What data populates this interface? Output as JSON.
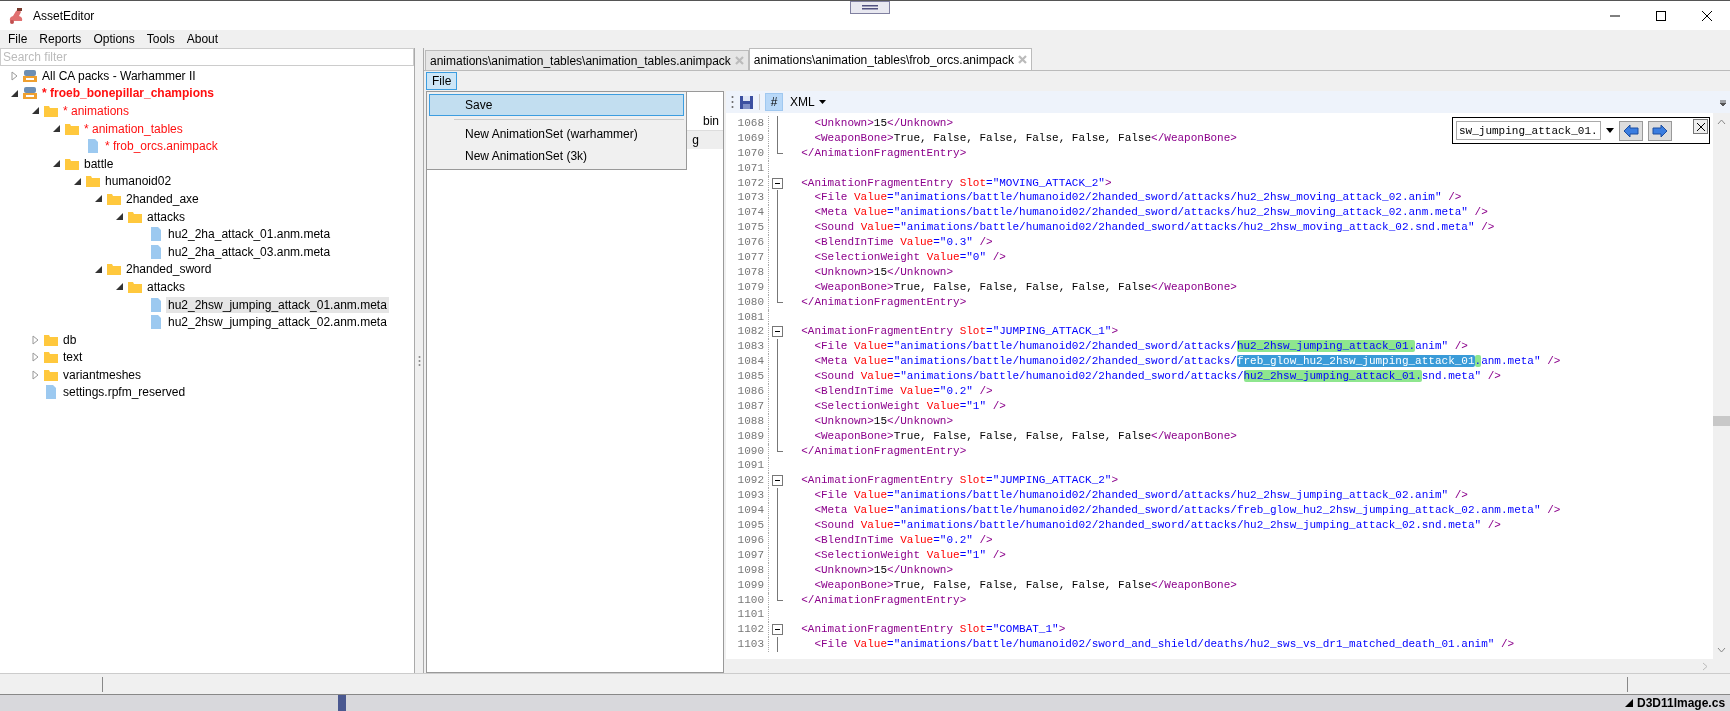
{
  "window": {
    "title": "AssetEditor"
  },
  "menu": [
    "File",
    "Reports",
    "Options",
    "Tools",
    "About"
  ],
  "sidebar": {
    "search": {
      "placeholder": "Search filter"
    },
    "tree": [
      {
        "kind": "pack",
        "label": "All CA packs - Warhammer II",
        "modified": false,
        "expanded": false,
        "selected": false
      },
      {
        "kind": "pack",
        "label": "* froeb_bonepillar_champions",
        "modified": true,
        "expanded": true,
        "selected": false,
        "children": [
          {
            "kind": "folder",
            "label": "* animations",
            "modified": true,
            "expanded": true,
            "selected": false,
            "children": [
              {
                "kind": "folder",
                "label": "* animation_tables",
                "modified": true,
                "expanded": true,
                "selected": false,
                "children": [
                  {
                    "kind": "file",
                    "label": "* frob_orcs.animpack",
                    "modified": true,
                    "selected": false
                  }
                ]
              },
              {
                "kind": "folder",
                "label": "battle",
                "modified": false,
                "expanded": true,
                "selected": false,
                "children": [
                  {
                    "kind": "folder",
                    "label": "humanoid02",
                    "modified": false,
                    "expanded": true,
                    "selected": false,
                    "children": [
                      {
                        "kind": "folder",
                        "label": "2handed_axe",
                        "modified": false,
                        "expanded": true,
                        "selected": false,
                        "children": [
                          {
                            "kind": "folder",
                            "label": "attacks",
                            "modified": false,
                            "expanded": true,
                            "selected": false,
                            "children": [
                              {
                                "kind": "file",
                                "label": "hu2_2ha_attack_01.anm.meta",
                                "modified": false,
                                "selected": false
                              },
                              {
                                "kind": "file",
                                "label": "hu2_2ha_attack_03.anm.meta",
                                "modified": false,
                                "selected": false
                              }
                            ]
                          }
                        ]
                      },
                      {
                        "kind": "folder",
                        "label": "2handed_sword",
                        "modified": false,
                        "expanded": true,
                        "selected": false,
                        "children": [
                          {
                            "kind": "folder",
                            "label": "attacks",
                            "modified": false,
                            "expanded": true,
                            "selected": false,
                            "children": [
                              {
                                "kind": "file",
                                "label": "hu2_2hsw_jumping_attack_01.anm.meta",
                                "modified": false,
                                "selected": true
                              },
                              {
                                "kind": "file",
                                "label": "hu2_2hsw_jumping_attack_02.anm.meta",
                                "modified": false,
                                "selected": false
                              }
                            ]
                          }
                        ]
                      }
                    ]
                  }
                ]
              }
            ]
          },
          {
            "kind": "folder",
            "label": "db",
            "modified": false,
            "expanded": false,
            "selected": false
          },
          {
            "kind": "folder",
            "label": "text",
            "modified": false,
            "expanded": false,
            "selected": false
          },
          {
            "kind": "folder",
            "label": "variantmeshes",
            "modified": false,
            "expanded": false,
            "selected": false
          },
          {
            "kind": "file",
            "label": "settings.rpfm_reserved",
            "modified": false,
            "selected": false
          }
        ]
      }
    ]
  },
  "tabs": [
    {
      "label": "animations\\animation_tables\\animation_tables.animpack",
      "selected": false
    },
    {
      "label": "animations\\animation_tables\\frob_orcs.animpack",
      "selected": true
    }
  ],
  "document": {
    "menu": [
      {
        "label": "File",
        "open": true
      }
    ],
    "file_menu": [
      {
        "kind": "item",
        "label": "Save",
        "selected": true
      },
      {
        "kind": "separator"
      },
      {
        "kind": "item",
        "label": "New AnimationSet (warhammer)",
        "selected": false
      },
      {
        "kind": "item",
        "label": "New AnimationSet (3k)",
        "selected": false
      }
    ],
    "table": {
      "columns": [
        "bin"
      ],
      "rows": [
        [
          "g"
        ]
      ]
    },
    "editor": {
      "toolbar": {
        "hash_toggle": {
          "label": "#",
          "on": true
        },
        "language": "XML"
      },
      "find": {
        "value": "sw_jumping_attack_01."
      },
      "lines": [
        {
          "number": "1068",
          "kind": "body",
          "tokens": [
            {
              "kind": "tag",
              "text": "    <Unknown>"
            },
            {
              "kind": "text",
              "text": "15"
            },
            {
              "kind": "tag",
              "text": "</Unknown>"
            }
          ]
        },
        {
          "number": "1069",
          "kind": "body",
          "tokens": [
            {
              "kind": "tag",
              "text": "    <WeaponBone>"
            },
            {
              "kind": "text",
              "text": "True, False, False, False, False, False"
            },
            {
              "kind": "tag",
              "text": "</WeaponBone>"
            }
          ]
        },
        {
          "number": "1070",
          "kind": "end",
          "tokens": [
            {
              "kind": "tag",
              "text": "  </AnimationFragmentEntry>"
            }
          ]
        },
        {
          "number": "1071",
          "kind": "blank"
        },
        {
          "number": "1072",
          "kind": "open",
          "tokens": [
            {
              "kind": "tag",
              "text": "  <AnimationFragmentEntry "
            },
            {
              "kind": "attr",
              "text": "Slot"
            },
            {
              "kind": "value",
              "text": "=\"MOVING_ATTACK_2\""
            },
            {
              "kind": "tag",
              "text": ">"
            }
          ]
        },
        {
          "number": "1073",
          "kind": "body",
          "tokens": [
            {
              "kind": "tag",
              "text": "    <File "
            },
            {
              "kind": "attr",
              "text": "Value"
            },
            {
              "kind": "value",
              "text": "=\"animations/battle/humanoid02/2handed_sword/attacks/hu2_2hsw_moving_attack_02.anim\""
            },
            {
              "kind": "tag",
              "text": " />"
            }
          ]
        },
        {
          "number": "1074",
          "kind": "body",
          "tokens": [
            {
              "kind": "tag",
              "text": "    <Meta "
            },
            {
              "kind": "attr",
              "text": "Value"
            },
            {
              "kind": "value",
              "text": "=\"animations/battle/humanoid02/2handed_sword/attacks/hu2_2hsw_moving_attack_02.anm.meta\""
            },
            {
              "kind": "tag",
              "text": " />"
            }
          ]
        },
        {
          "number": "1075",
          "kind": "body",
          "tokens": [
            {
              "kind": "tag",
              "text": "    <Sound "
            },
            {
              "kind": "attr",
              "text": "Value"
            },
            {
              "kind": "value",
              "text": "=\"animations/battle/humanoid02/2handed_sword/attacks/hu2_2hsw_moving_attack_02.snd.meta\""
            },
            {
              "kind": "tag",
              "text": " />"
            }
          ]
        },
        {
          "number": "1076",
          "kind": "body",
          "tokens": [
            {
              "kind": "tag",
              "text": "    <BlendInTime "
            },
            {
              "kind": "attr",
              "text": "Value"
            },
            {
              "kind": "value",
              "text": "=\"0.3\""
            },
            {
              "kind": "tag",
              "text": " />"
            }
          ]
        },
        {
          "number": "1077",
          "kind": "body",
          "tokens": [
            {
              "kind": "tag",
              "text": "    <SelectionWeight "
            },
            {
              "kind": "attr",
              "text": "Value"
            },
            {
              "kind": "value",
              "text": "=\"0\""
            },
            {
              "kind": "tag",
              "text": " />"
            }
          ]
        },
        {
          "number": "1078",
          "kind": "body",
          "tokens": [
            {
              "kind": "tag",
              "text": "    <Unknown>"
            },
            {
              "kind": "text",
              "text": "15"
            },
            {
              "kind": "tag",
              "text": "</Unknown>"
            }
          ]
        },
        {
          "number": "1079",
          "kind": "body",
          "tokens": [
            {
              "kind": "tag",
              "text": "    <WeaponBone>"
            },
            {
              "kind": "text",
              "text": "True, False, False, False, False, False"
            },
            {
              "kind": "tag",
              "text": "</WeaponBone>"
            }
          ]
        },
        {
          "number": "1080",
          "kind": "end",
          "tokens": [
            {
              "kind": "tag",
              "text": "  </AnimationFragmentEntry>"
            }
          ]
        },
        {
          "number": "1081",
          "kind": "blank"
        },
        {
          "number": "1082",
          "kind": "open",
          "tokens": [
            {
              "kind": "tag",
              "text": "  <AnimationFragmentEntry "
            },
            {
              "kind": "attr",
              "text": "Slot"
            },
            {
              "kind": "value",
              "text": "=\"JUMPING_ATTACK_1\""
            },
            {
              "kind": "tag",
              "text": ">"
            }
          ]
        },
        {
          "number": "1083",
          "kind": "body",
          "tokens": [
            {
              "kind": "tag",
              "text": "    <File "
            },
            {
              "kind": "attr",
              "text": "Value"
            },
            {
              "kind": "value",
              "text": "=\"animations/battle/humanoid02/2handed_sword/attacks/"
            },
            {
              "kind": "value",
              "text": "hu2_2hsw_jumping_attack_01.",
              "hit": true
            },
            {
              "kind": "value",
              "text": "anim\""
            },
            {
              "kind": "tag",
              "text": " />"
            }
          ]
        },
        {
          "number": "1084",
          "kind": "body",
          "tokens": [
            {
              "kind": "tag",
              "text": "    <Meta "
            },
            {
              "kind": "attr",
              "text": "Value"
            },
            {
              "kind": "value",
              "text": "=\"animations/battle/humanoid02/2handed_sword/attacks/"
            },
            {
              "kind": "value",
              "text": "freb_glow_hu2_2hsw_jumping_attack_01",
              "hit": true,
              "current": true
            },
            {
              "kind": "value",
              "text": ".",
              "hit": true
            },
            {
              "kind": "value",
              "text": "anm.meta\""
            },
            {
              "kind": "tag",
              "text": " />"
            }
          ]
        },
        {
          "number": "1085",
          "kind": "body",
          "tokens": [
            {
              "kind": "tag",
              "text": "    <Sound "
            },
            {
              "kind": "attr",
              "text": "Value"
            },
            {
              "kind": "value",
              "text": "=\"animations/battle/humanoid02/2handed_sword/attacks/"
            },
            {
              "kind": "value",
              "text": "hu2_2hsw_jumping_attack_01.",
              "hit": true
            },
            {
              "kind": "value",
              "text": "snd.meta\""
            },
            {
              "kind": "tag",
              "text": " />"
            }
          ]
        },
        {
          "number": "1086",
          "kind": "body",
          "tokens": [
            {
              "kind": "tag",
              "text": "    <BlendInTime "
            },
            {
              "kind": "attr",
              "text": "Value"
            },
            {
              "kind": "value",
              "text": "=\"0.2\""
            },
            {
              "kind": "tag",
              "text": " />"
            }
          ]
        },
        {
          "number": "1087",
          "kind": "body",
          "tokens": [
            {
              "kind": "tag",
              "text": "    <SelectionWeight "
            },
            {
              "kind": "attr",
              "text": "Value"
            },
            {
              "kind": "value",
              "text": "=\"1\""
            },
            {
              "kind": "tag",
              "text": " />"
            }
          ]
        },
        {
          "number": "1088",
          "kind": "body",
          "tokens": [
            {
              "kind": "tag",
              "text": "    <Unknown>"
            },
            {
              "kind": "text",
              "text": "15"
            },
            {
              "kind": "tag",
              "text": "</Unknown>"
            }
          ]
        },
        {
          "number": "1089",
          "kind": "body",
          "tokens": [
            {
              "kind": "tag",
              "text": "    <WeaponBone>"
            },
            {
              "kind": "text",
              "text": "True, False, False, False, False, False"
            },
            {
              "kind": "tag",
              "text": "</WeaponBone>"
            }
          ]
        },
        {
          "number": "1090",
          "kind": "end",
          "tokens": [
            {
              "kind": "tag",
              "text": "  </AnimationFragmentEntry>"
            }
          ]
        },
        {
          "number": "1091",
          "kind": "blank"
        },
        {
          "number": "1092",
          "kind": "open",
          "tokens": [
            {
              "kind": "tag",
              "text": "  <AnimationFragmentEntry "
            },
            {
              "kind": "attr",
              "text": "Slot"
            },
            {
              "kind": "value",
              "text": "=\"JUMPING_ATTACK_2\""
            },
            {
              "kind": "tag",
              "text": ">"
            }
          ]
        },
        {
          "number": "1093",
          "kind": "body",
          "tokens": [
            {
              "kind": "tag",
              "text": "    <File "
            },
            {
              "kind": "attr",
              "text": "Value"
            },
            {
              "kind": "value",
              "text": "=\"animations/battle/humanoid02/2handed_sword/attacks/hu2_2hsw_jumping_attack_02.anim\""
            },
            {
              "kind": "tag",
              "text": " />"
            }
          ]
        },
        {
          "number": "1094",
          "kind": "body",
          "tokens": [
            {
              "kind": "tag",
              "text": "    <Meta "
            },
            {
              "kind": "attr",
              "text": "Value"
            },
            {
              "kind": "value",
              "text": "=\"animations/battle/humanoid02/2handed_sword/attacks/freb_glow_hu2_2hsw_jumping_attack_02.anm.meta\""
            },
            {
              "kind": "tag",
              "text": " />"
            }
          ]
        },
        {
          "number": "1095",
          "kind": "body",
          "tokens": [
            {
              "kind": "tag",
              "text": "    <Sound "
            },
            {
              "kind": "attr",
              "text": "Value"
            },
            {
              "kind": "value",
              "text": "=\"animations/battle/humanoid02/2handed_sword/attacks/hu2_2hsw_jumping_attack_02.snd.meta\""
            },
            {
              "kind": "tag",
              "text": " />"
            }
          ]
        },
        {
          "number": "1096",
          "kind": "body",
          "tokens": [
            {
              "kind": "tag",
              "text": "    <BlendInTime "
            },
            {
              "kind": "attr",
              "text": "Value"
            },
            {
              "kind": "value",
              "text": "=\"0.2\""
            },
            {
              "kind": "tag",
              "text": " />"
            }
          ]
        },
        {
          "number": "1097",
          "kind": "body",
          "tokens": [
            {
              "kind": "tag",
              "text": "    <SelectionWeight "
            },
            {
              "kind": "attr",
              "text": "Value"
            },
            {
              "kind": "value",
              "text": "=\"1\""
            },
            {
              "kind": "tag",
              "text": " />"
            }
          ]
        },
        {
          "number": "1098",
          "kind": "body",
          "tokens": [
            {
              "kind": "tag",
              "text": "    <Unknown>"
            },
            {
              "kind": "text",
              "text": "15"
            },
            {
              "kind": "tag",
              "text": "</Unknown>"
            }
          ]
        },
        {
          "number": "1099",
          "kind": "body",
          "tokens": [
            {
              "kind": "tag",
              "text": "    <WeaponBone>"
            },
            {
              "kind": "text",
              "text": "True, False, False, False, False, False"
            },
            {
              "kind": "tag",
              "text": "</WeaponBone>"
            }
          ]
        },
        {
          "number": "1100",
          "kind": "end",
          "tokens": [
            {
              "kind": "tag",
              "text": "  </AnimationFragmentEntry>"
            }
          ]
        },
        {
          "number": "1101",
          "kind": "blank"
        },
        {
          "number": "1102",
          "kind": "open",
          "tokens": [
            {
              "kind": "tag",
              "text": "  <AnimationFragmentEntry "
            },
            {
              "kind": "attr",
              "text": "Slot"
            },
            {
              "kind": "value",
              "text": "=\"COMBAT_1\""
            },
            {
              "kind": "tag",
              "text": ">"
            }
          ]
        },
        {
          "number": "1103",
          "kind": "body",
          "tokens": [
            {
              "kind": "tag",
              "text": "    <File "
            },
            {
              "kind": "attr",
              "text": "Value"
            },
            {
              "kind": "value",
              "text": "=\"animations/battle/humanoid02/sword_and_shield/deaths/hu2_sws_vs_dr1_matched_death_01.anim\""
            },
            {
              "kind": "tag",
              "text": " />"
            }
          ]
        }
      ]
    }
  },
  "taskbar": {
    "item": "D3D11Image.cs"
  }
}
